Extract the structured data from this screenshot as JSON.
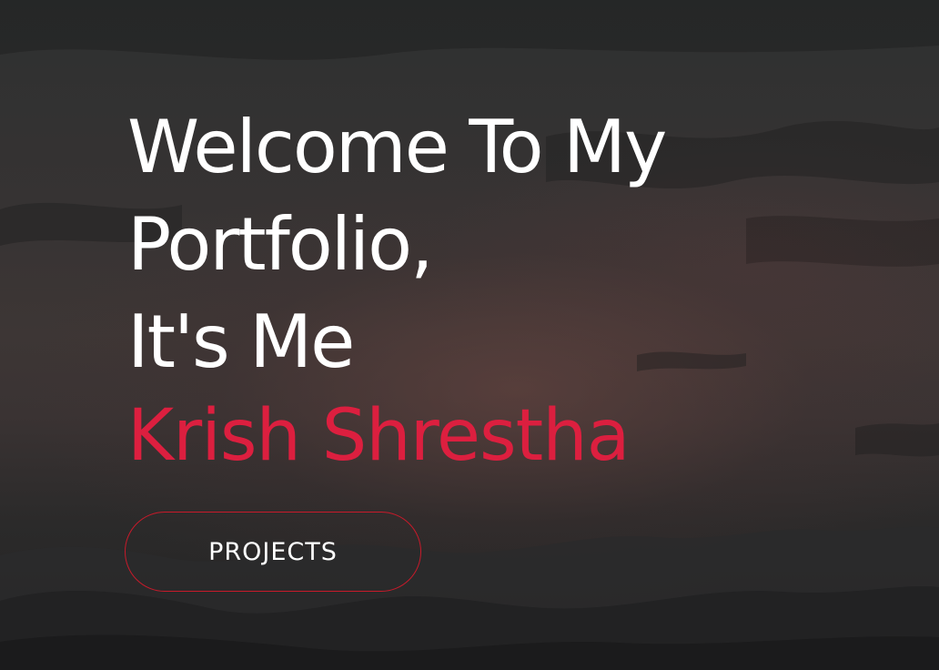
{
  "hero": {
    "headline_lines": [
      "Welcome To My",
      "Portfolio,",
      "It's Me"
    ],
    "name": "Krish Shrestha",
    "accent_color": "#dc1f3f",
    "button": {
      "label": "PROJECTS",
      "border_color": "#c81a2a"
    }
  }
}
